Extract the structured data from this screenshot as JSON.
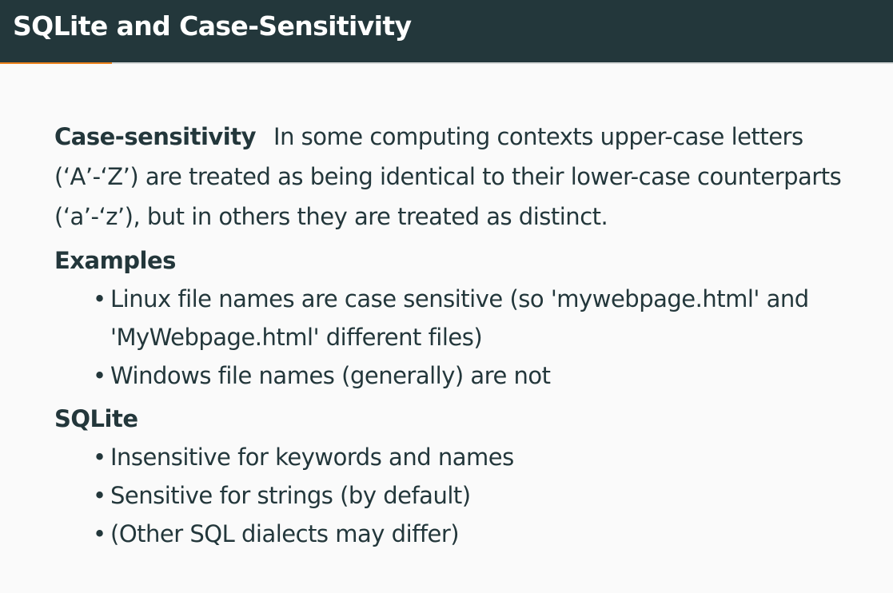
{
  "slide": {
    "title": "SQLite and Case-Sensitivity"
  },
  "definition": {
    "term": "Case-sensitivity",
    "text": "In some computing contexts upper-case letters (‘A’-‘Z’) are treated as being identical to their lower-case counterparts (‘a’-‘z’), but in others they are treated as distinct."
  },
  "examples": {
    "heading": "Examples",
    "items": [
      {
        "bullet": "•",
        "text": "Linux file names are case sensitive (so 'mywebpage.html' and 'MyWebpage.html' different files)"
      },
      {
        "bullet": "•",
        "text": "Windows file names (generally) are not"
      }
    ]
  },
  "sqlite": {
    "heading": "SQLite",
    "items": [
      {
        "bullet": "•",
        "text": "Insensitive for keywords and names"
      },
      {
        "bullet": "•",
        "text": "Sensitive for strings (by default)"
      },
      {
        "bullet": "•",
        "text": "(Other SQL dialects may differ)"
      }
    ]
  },
  "colors": {
    "header_bg": "#23373b",
    "accent": "#eb811b",
    "body_bg": "#fafafa",
    "text": "#23373b"
  }
}
